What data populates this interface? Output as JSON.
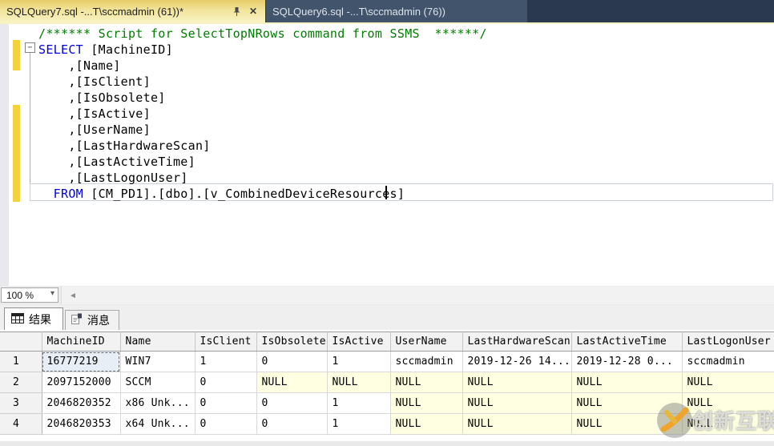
{
  "tabs": {
    "active": {
      "title": "SQLQuery7.sql -...T\\sccmadmin (61))*"
    },
    "inactive": {
      "title": "SQLQuery6.sql -...T\\sccmadmin (76))"
    }
  },
  "editor": {
    "lines": [
      {
        "segments": [
          {
            "text": "/****** Script for SelectTopNRows command from SSMS  ******/",
            "color": "comment"
          }
        ]
      },
      {
        "segments": [
          {
            "text": "SELECT",
            "color": "keyword"
          },
          {
            "text": " [MachineID]",
            "color": "plain"
          }
        ]
      },
      {
        "segments": [
          {
            "text": "    ,[Name]",
            "color": "plain"
          }
        ]
      },
      {
        "segments": [
          {
            "text": "    ,[IsClient]",
            "color": "plain"
          }
        ]
      },
      {
        "segments": [
          {
            "text": "    ,[IsObsolete]",
            "color": "plain"
          }
        ]
      },
      {
        "segments": [
          {
            "text": "    ,[IsActive]",
            "color": "plain"
          }
        ]
      },
      {
        "segments": [
          {
            "text": "    ,[UserName]",
            "color": "plain"
          }
        ]
      },
      {
        "segments": [
          {
            "text": "    ,[LastHardwareScan]",
            "color": "plain"
          }
        ]
      },
      {
        "segments": [
          {
            "text": "    ,[LastActiveTime]",
            "color": "plain"
          }
        ]
      },
      {
        "segments": [
          {
            "text": "    ,[LastLogonUser]",
            "color": "plain"
          }
        ]
      },
      {
        "segments": [
          {
            "text": "  ",
            "color": "plain"
          },
          {
            "text": "FROM",
            "color": "keyword"
          },
          {
            "text": " [CM_PD1].[dbo].[v_CombinedDeviceResources]",
            "color": "plain"
          }
        ]
      }
    ],
    "fold_glyph": "−"
  },
  "zoom_control": {
    "value": "100 %",
    "dropdown_arrow": "▾"
  },
  "editor_scrollbar": {
    "left_arrow": "◄"
  },
  "result_tabs": {
    "results": "结果",
    "messages": "消息"
  },
  "grid": {
    "columns": [
      "",
      "MachineID",
      "Name",
      "IsClient",
      "IsObsolete",
      "IsActive",
      "UserName",
      "LastHardwareScan",
      "LastActiveTime",
      "LastLogonUser"
    ],
    "rows": [
      {
        "num": "1",
        "cells": [
          {
            "v": "16777219",
            "selected": true
          },
          {
            "v": "WIN7"
          },
          {
            "v": "1"
          },
          {
            "v": "0"
          },
          {
            "v": "1"
          },
          {
            "v": "sccmadmin"
          },
          {
            "v": "2019-12-26 14..."
          },
          {
            "v": "2019-12-28 0..."
          },
          {
            "v": "sccmadmin"
          }
        ]
      },
      {
        "num": "2",
        "cells": [
          {
            "v": "2097152000"
          },
          {
            "v": "SCCM"
          },
          {
            "v": "0"
          },
          {
            "v": "NULL",
            "null": true
          },
          {
            "v": "NULL",
            "null": true
          },
          {
            "v": "NULL",
            "null": true
          },
          {
            "v": "NULL",
            "null": true
          },
          {
            "v": "NULL",
            "null": true
          },
          {
            "v": "NULL",
            "null": true
          }
        ]
      },
      {
        "num": "3",
        "cells": [
          {
            "v": "2046820352"
          },
          {
            "v": "x86 Unk..."
          },
          {
            "v": "0"
          },
          {
            "v": "0"
          },
          {
            "v": "1"
          },
          {
            "v": "NULL",
            "null": true
          },
          {
            "v": "NULL",
            "null": true
          },
          {
            "v": "NULL",
            "null": true
          },
          {
            "v": "NULL",
            "null": true
          }
        ]
      },
      {
        "num": "4",
        "cells": [
          {
            "v": "2046820353"
          },
          {
            "v": "x64 Unk..."
          },
          {
            "v": "0"
          },
          {
            "v": "0"
          },
          {
            "v": "1"
          },
          {
            "v": "NULL",
            "null": true
          },
          {
            "v": "NULL",
            "null": true
          },
          {
            "v": "NULL",
            "null": true
          },
          {
            "v": "NULL",
            "null": true
          }
        ]
      }
    ]
  },
  "watermark": {
    "text": "创新互联"
  },
  "colors": {
    "tab_active_bg": "#f2e49c",
    "tab_inactive_bg": "#41546b",
    "tabstrip_bg": "#2a3950",
    "keyword": "#0000e0",
    "comment": "#007d00",
    "change_bar": "#f2d33c",
    "null_cell_bg": "#ffffe1",
    "watermark_orange": "#f0a42b"
  }
}
